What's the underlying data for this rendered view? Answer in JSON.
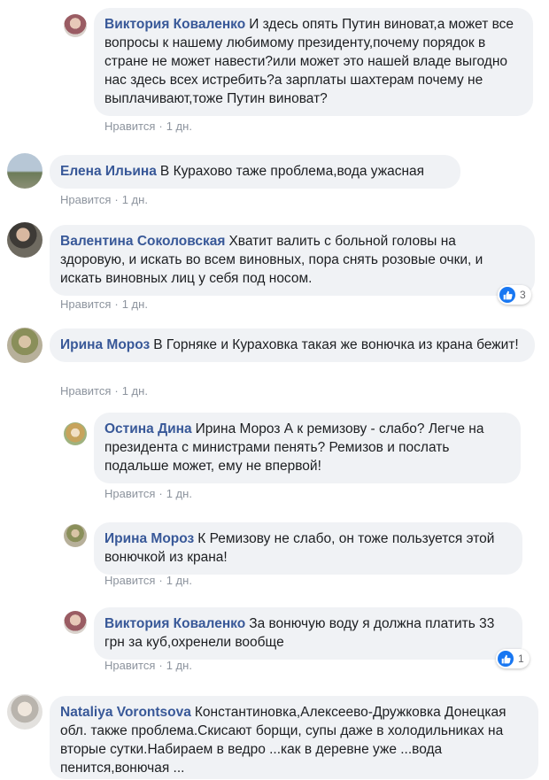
{
  "like_label": "Нравится",
  "separator": "·",
  "comments": [
    {
      "author": "Виктория Коваленко",
      "text": "И здесь опять Путин виноват,а может все вопросы к нашему любимому президенту,почему порядок в стране не может навести?или может это нашей владе выгодно нас здесь всех истребить?а зарплаты шахтерам почему не выплачивают,тоже Путин виноват?",
      "time": "1 дн."
    },
    {
      "author": "Елена Ильина",
      "text": "В Курахово таже проблема,вода ужасная",
      "time": "1 дн."
    },
    {
      "author": "Валентина Соколовская",
      "text": "Хватит валить с больной головы на здоровую, и искать во всем виновных, пора снять розовые очки, и искать виновных лиц у себя под носом.",
      "time": "1 дн.",
      "reaction_count": "3"
    },
    {
      "author": "Ирина Мороз",
      "text": "В Горняке и Кураховка такая же вонючка из крана бежит!",
      "time": "1 дн."
    },
    {
      "author": "Остина Дина",
      "text": "Ирина Мороз А к ремизову - слабо? Легче на президента с министрами пенять? Ремизов и послать подальше может, ему не впервой!",
      "time": "1 дн."
    },
    {
      "author": "Ирина Мороз",
      "text": "К Ремизову не слабо, он тоже пользуется этой вонючкой из крана!",
      "time": "1 дн."
    },
    {
      "author": "Виктория Коваленко",
      "text": "За вонючую воду я должна платить 33 грн за куб,охренели вообще",
      "time": "1 дн.",
      "reaction_count": "1"
    },
    {
      "author": "Nataliya Vorontsova",
      "text": "Константиновка,Алексеево-Дружковка Донецкая обл. также проблема.Скисают борщи, супы даже в холодильниках на вторые сутки.Набираем в ведро ...как в деревне уже ...вода пенится,вонючая ..."
    }
  ]
}
